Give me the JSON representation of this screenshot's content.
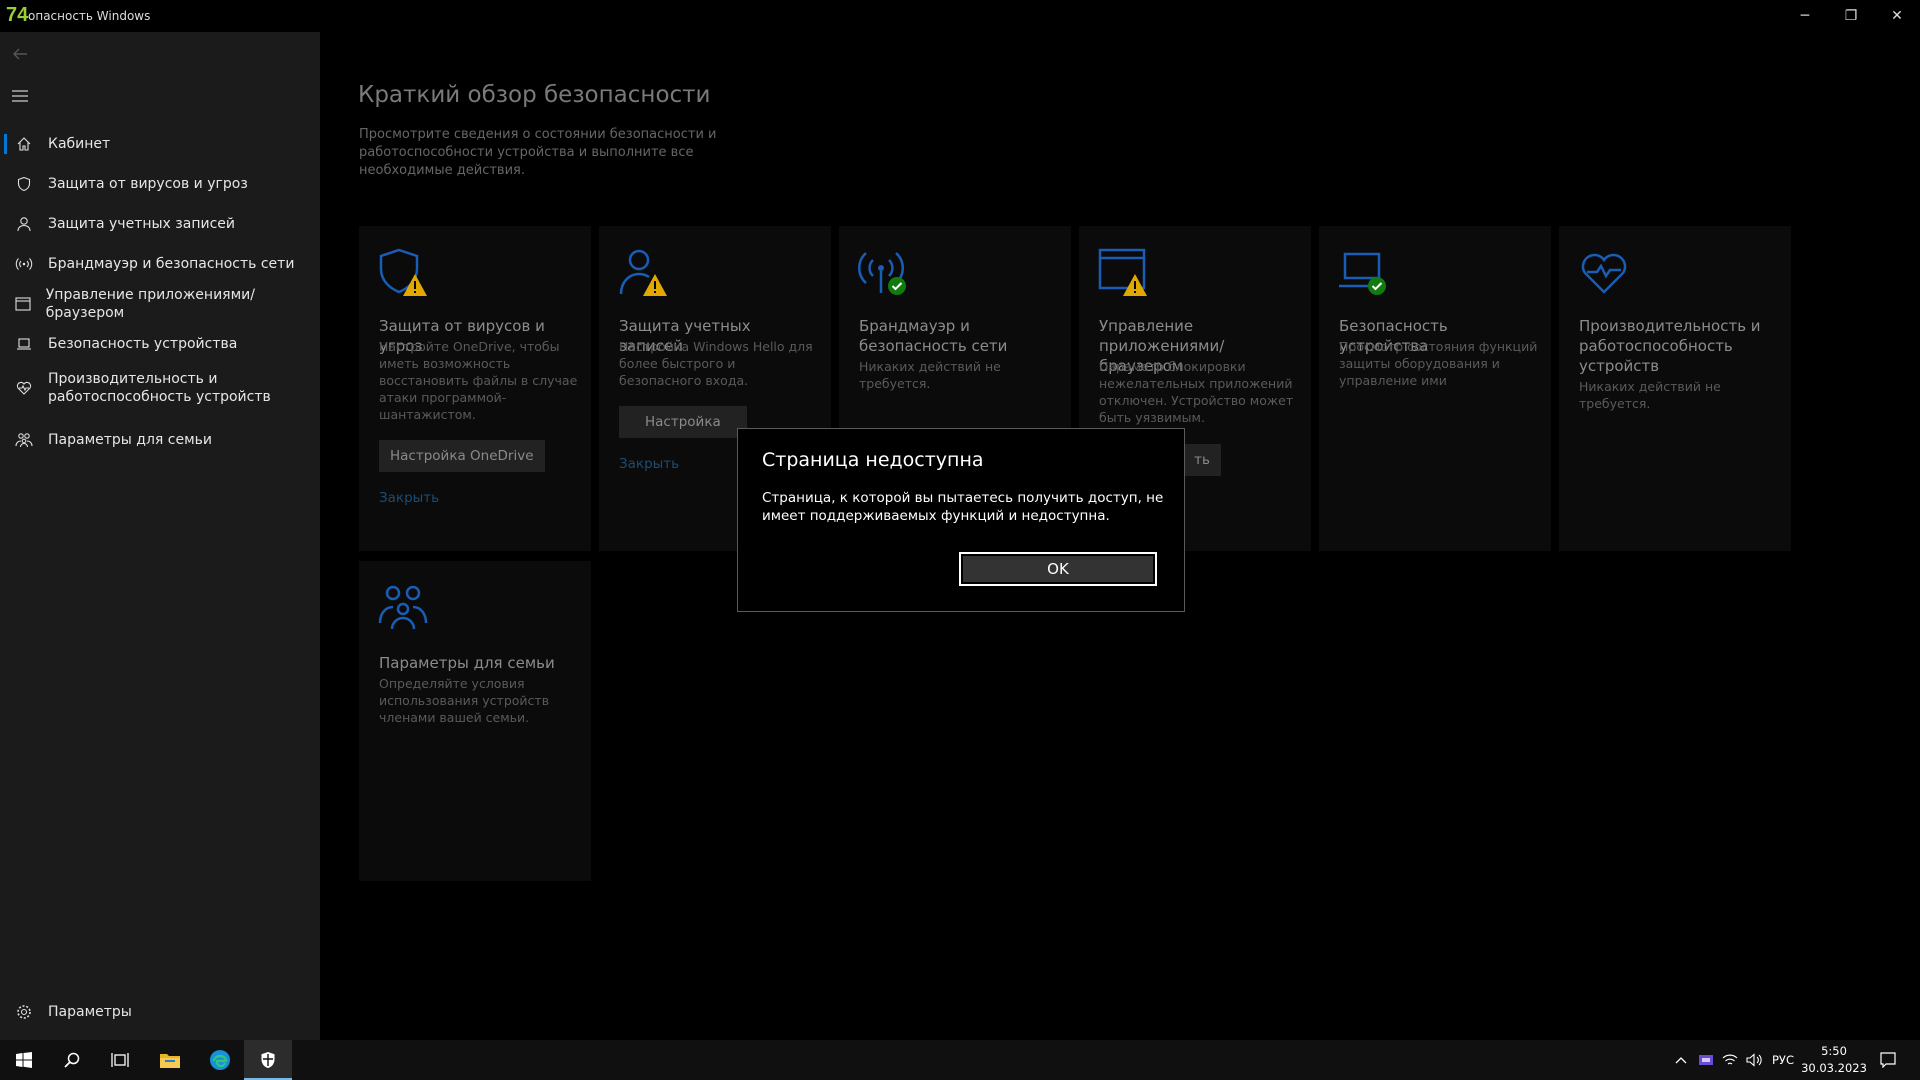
{
  "window": {
    "badge": "74",
    "title": "опасность Windows",
    "controls": {
      "minimize": "─",
      "restore": "❐",
      "close": "✕"
    }
  },
  "sidebar": {
    "items": [
      {
        "label": "Кабинет",
        "icon": "home-icon",
        "active": true
      },
      {
        "label": "Защита от вирусов и угроз",
        "icon": "shield-icon"
      },
      {
        "label": "Защита учетных записей",
        "icon": "person-icon"
      },
      {
        "label": "Брандмауэр и безопасность сети",
        "icon": "antenna-icon"
      },
      {
        "label": "Управление приложениями/браузером",
        "icon": "app-window-icon"
      },
      {
        "label": "Безопасность устройства",
        "icon": "laptop-icon"
      },
      {
        "label": "Производительность и работоспособность устройств",
        "icon": "heart-icon"
      },
      {
        "label": "Параметры для семьи",
        "icon": "family-icon"
      }
    ],
    "settings_label": "Параметры"
  },
  "main": {
    "title": "Краткий обзор безопасности",
    "description": "Просмотрите сведения о состоянии безопасности и работоспособности устройства и выполните все необходимые действия.",
    "cards": [
      {
        "title": "Защита от вирусов и угроз",
        "desc": "Настройте OneDrive, чтобы иметь возможность восстановить файлы в случае атаки программой-шантажистом.",
        "button": "Настройка OneDrive",
        "link": "Закрыть",
        "status": "warning"
      },
      {
        "title": "Защита учетных записей",
        "desc": "Настройка Windows Hello для более быстрого и безопасного входа.",
        "button": "Настройка",
        "link": "Закрыть",
        "status": "warning"
      },
      {
        "title": "Брандмауэр и безопасность сети",
        "desc": "Никаких действий не требуется.",
        "status": "ok"
      },
      {
        "title": "Управление приложениями/браузером",
        "desc": "Параметр блокировки нежелательных приложений отключен. Устройство может быть уязвимым.",
        "button": "ть",
        "status": "warning"
      },
      {
        "title": "Безопасность устройства",
        "desc": "Просмотр состояния функций защиты оборудования и управление ими",
        "status": "ok"
      },
      {
        "title": "Производительность и работоспособность устройств",
        "desc": "Никаких действий не требуется.",
        "status": "none"
      },
      {
        "title": "Параметры для семьи",
        "desc": "Определяйте условия использования устройств членами вашей семьи.",
        "status": "none"
      }
    ]
  },
  "dialog": {
    "title": "Страница недоступна",
    "message": "Страница, к которой вы пытаетесь получить доступ, не имеет поддерживаемых функций и недоступна.",
    "ok": "OK"
  },
  "taskbar": {
    "lang": "РУС",
    "time": "5:50",
    "date": "30.03.2023",
    "apps": [
      "start-icon",
      "search-icon",
      "task-view-icon",
      "file-explorer-icon",
      "edge-icon",
      "windows-security-icon"
    ]
  },
  "colors": {
    "accent": "#0078d7",
    "warning": "#e0a800",
    "ok": "#107c10",
    "icon_blue": "#1a5db4"
  }
}
